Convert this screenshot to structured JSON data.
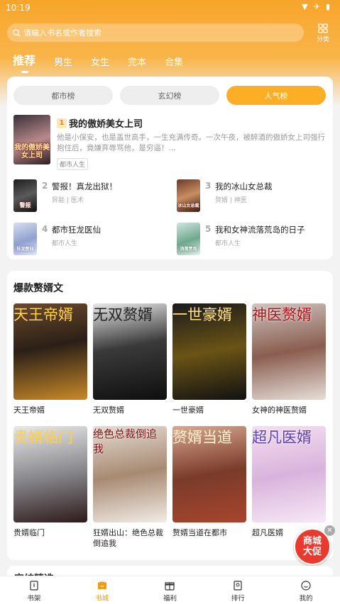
{
  "status": {
    "time": "10:19"
  },
  "search": {
    "placeholder": "请输入书名或作者搜索"
  },
  "category_button": {
    "label": "分类"
  },
  "tabs": [
    {
      "label": "推荐",
      "active": true
    },
    {
      "label": "男生"
    },
    {
      "label": "女生"
    },
    {
      "label": "完本"
    },
    {
      "label": "合集"
    }
  ],
  "rank_tabs": [
    {
      "label": "都市榜"
    },
    {
      "label": "玄幻榜"
    },
    {
      "label": "人气榜",
      "active": true
    }
  ],
  "top_book": {
    "rank": "1",
    "title": "我的傲娇美女上司",
    "desc": "他是小保安，也是盖世高手，一生充满传奇。一次午夜，被醉酒的傲娇女上司强行抱住后，竟嫌弃辱骂他，是穷逼！...",
    "tag": "都市人生",
    "cover_text": "我的傲娇美女上司"
  },
  "rank_list": [
    {
      "rank": "2",
      "title": "警报！真龙出狱！",
      "meta": "异能 | 医术",
      "cover_text": "警报"
    },
    {
      "rank": "3",
      "title": "我的冰山女总裁",
      "meta": "赘婿 | 神医",
      "cover_text": "冰山女总裁"
    },
    {
      "rank": "4",
      "title": "都市狂龙医仙",
      "meta": "都市人生",
      "cover_text": "狂龙医仙"
    },
    {
      "rank": "5",
      "title": "我和女神流落荒岛的日子",
      "meta": "都市人生",
      "cover_text": "流落荒岛"
    }
  ],
  "section": {
    "title": "爆款赘婿文",
    "books": [
      {
        "title": "天王帝婿",
        "cover_text": "天王帝婿"
      },
      {
        "title": "无双赘婿",
        "cover_text": "无双赘婿"
      },
      {
        "title": "一世豪婿",
        "cover_text": "一世豪婿"
      },
      {
        "title": "女神的神医赘婿",
        "cover_text": "神医赘婿"
      },
      {
        "title": "贵婿临门",
        "cover_text": "贵婿临门"
      },
      {
        "title": "狂婿出山：绝色总裁倒追我",
        "cover_text": "绝色总裁倒追我"
      },
      {
        "title": "赘婿当道在都市",
        "cover_text": "赘婿当道"
      },
      {
        "title": "超凡医婿",
        "cover_text": "超凡医婿"
      }
    ]
  },
  "promo_badge": {
    "line1": "商城",
    "line2": "大促"
  },
  "next_section": {
    "title": "完结精选"
  },
  "nav": [
    {
      "label": "书架"
    },
    {
      "label": "书城",
      "active": true
    },
    {
      "label": "福利"
    },
    {
      "label": "排行"
    },
    {
      "label": "我的"
    }
  ],
  "colors": {
    "accent": "#fdae24",
    "active_nav": "#f39a0f",
    "badge": "#e83a2e"
  }
}
